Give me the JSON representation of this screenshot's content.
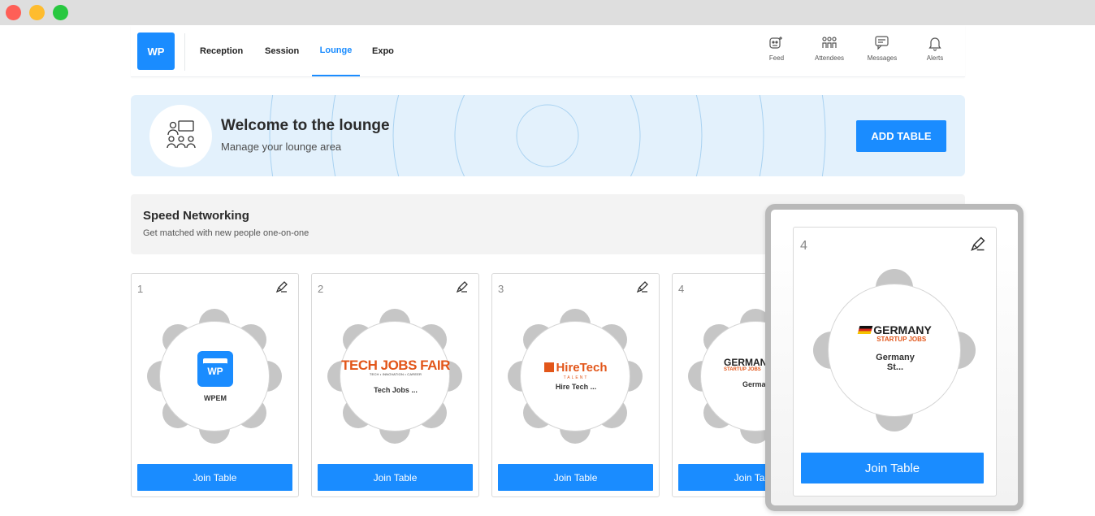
{
  "brand": {
    "logo_text": "WP",
    "accent": "#1a8cff"
  },
  "nav": {
    "tabs": [
      {
        "label": "Reception",
        "active": false
      },
      {
        "label": "Session",
        "active": false
      },
      {
        "label": "Lounge",
        "active": true
      },
      {
        "label": "Expo",
        "active": false
      }
    ],
    "icons": [
      {
        "label": "Feed",
        "icon": "feed-icon"
      },
      {
        "label": "Attendees",
        "icon": "attendees-icon"
      },
      {
        "label": "Messages",
        "icon": "messages-icon"
      },
      {
        "label": "Alerts",
        "icon": "bell-icon"
      }
    ]
  },
  "hero": {
    "title": "Welcome to the lounge",
    "subtitle": "Manage your lounge area",
    "add_table_label": "ADD TABLE"
  },
  "speed_networking": {
    "title": "Speed Networking",
    "subtitle": "Get matched with new people one-on-one"
  },
  "tables": [
    {
      "number": "1",
      "name": "WPEM",
      "logo": "wpem-logo",
      "logo_text": "WP",
      "join_label": "Join Table"
    },
    {
      "number": "2",
      "name": "Tech Jobs ...",
      "logo": "tech-jobs-fair-logo",
      "logo_text": "TECH JOBS FAIR",
      "logo_tagline": "TECH • INNOVATION • CAREER",
      "join_label": "Join Table"
    },
    {
      "number": "3",
      "name": "Hire Tech ...",
      "logo": "hiretech-logo",
      "logo_text": "HireTech",
      "logo_tagline": "TALENT",
      "join_label": "Join Table"
    },
    {
      "number": "4",
      "name": "Germany St...",
      "logo": "germany-startup-jobs-logo",
      "logo_text": "GERMANY",
      "logo_tagline": "STARTUP JOBS",
      "join_label": "Join Table"
    }
  ],
  "zoom": {
    "number": "4",
    "name_line1": "Germany",
    "name_line2": "St...",
    "logo_text": "GERMANY",
    "logo_tagline": "STARTUP JOBS",
    "join_label": "Join Table"
  }
}
